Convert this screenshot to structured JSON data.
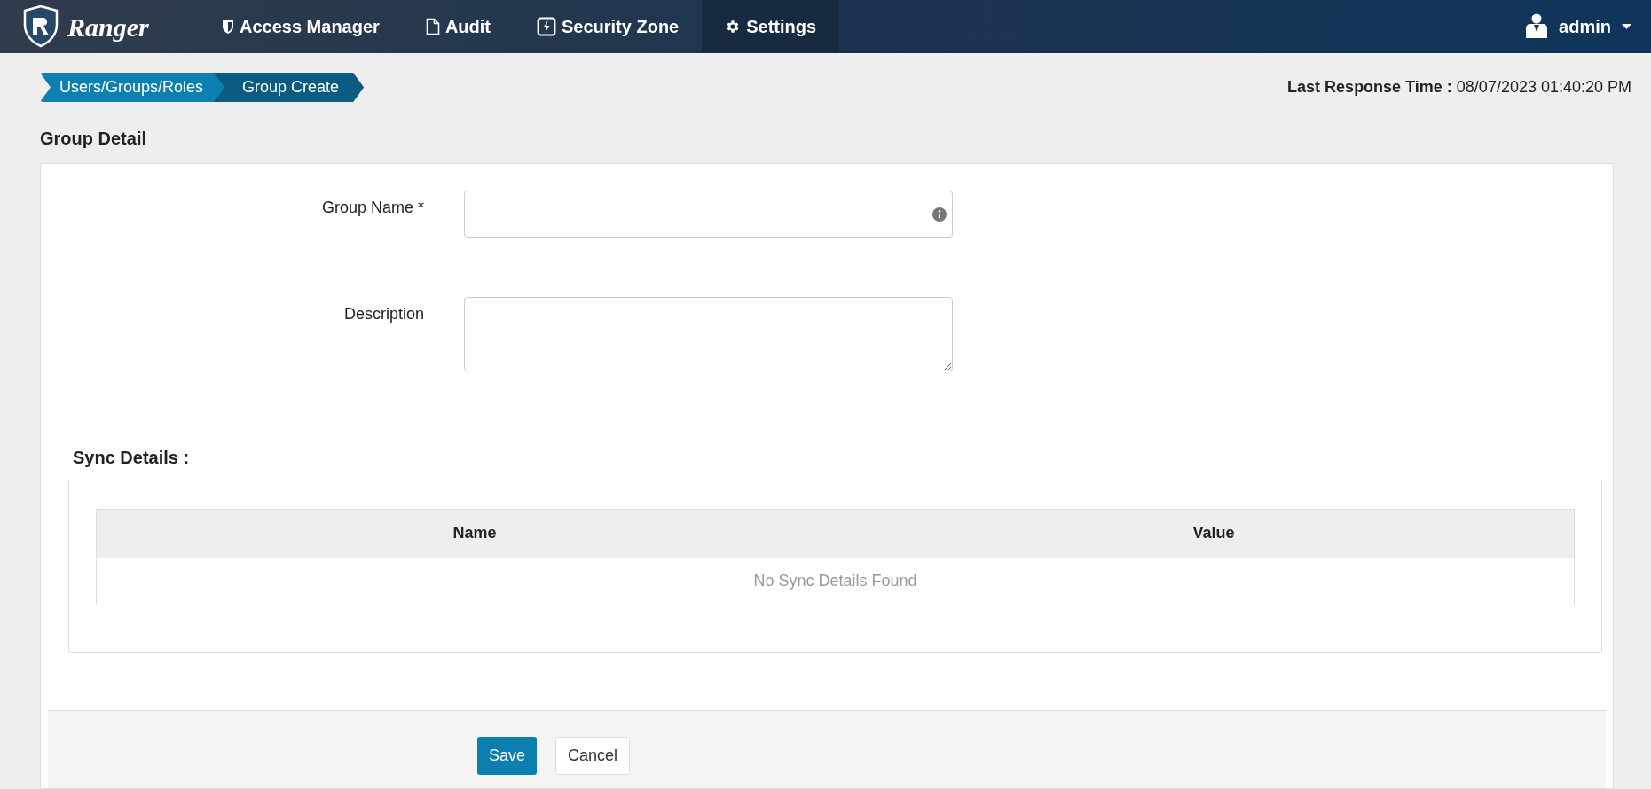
{
  "navbar": {
    "brand": "Ranger",
    "items": [
      {
        "label": "Access Manager",
        "kind": "shield",
        "selected": false
      },
      {
        "label": "Audit",
        "kind": "file",
        "selected": false
      },
      {
        "label": "Security Zone",
        "kind": "bolt",
        "selected": false
      },
      {
        "label": "Settings",
        "kind": "gear",
        "selected": true
      }
    ],
    "user": "admin"
  },
  "breadcrumb": [
    {
      "label": "Users/Groups/Roles",
      "selected": false
    },
    {
      "label": "Group Create",
      "selected": true
    }
  ],
  "last_response": {
    "label": "Last Response Time :",
    "value": "08/07/2023 01:40:20 PM"
  },
  "title": "Group Detail",
  "form": {
    "fields": [
      {
        "kind": "input",
        "label": "Group Name *"
      },
      {
        "kind": "textarea",
        "label": "Description"
      }
    ]
  },
  "sync": {
    "title": "Sync Details :",
    "columns": [
      "Name",
      "Value"
    ],
    "empty": "No Sync Details Found"
  },
  "buttons": [
    {
      "label": "Save",
      "kind": "primary"
    },
    {
      "label": "Cancel",
      "kind": "default"
    }
  ]
}
